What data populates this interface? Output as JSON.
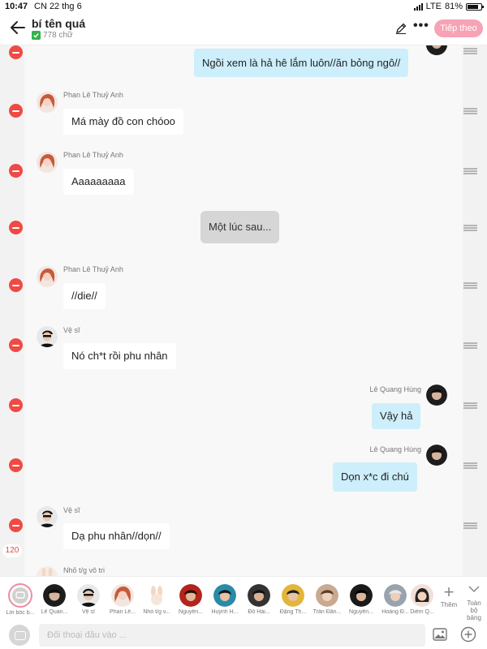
{
  "status_bar": {
    "time": "10:47",
    "date": "CN 22 thg 6",
    "network": "LTE",
    "battery": "81%",
    "battery_level": 0.81
  },
  "header": {
    "title": "bí tên quá",
    "word_count": "778 chữ",
    "continue_label": "Tiếp theo"
  },
  "messages": [
    {
      "side": "out",
      "avatar": "hung",
      "text": "Ngồi xem là hả hê lắm luôn//ăn bỏng ngô//"
    },
    {
      "side": "in",
      "sender": "Phan Lê Thuỷ Anh",
      "avatar": "thuy-anh",
      "text": "Má mày đồ con chóoo"
    },
    {
      "side": "in",
      "sender": "Phan Lê Thuỷ Anh",
      "avatar": "thuy-anh",
      "text": "Aaaaaaaaa"
    },
    {
      "side": "center",
      "text": "Một lúc sau..."
    },
    {
      "side": "in",
      "sender": "Phan Lê Thuỷ Anh",
      "avatar": "thuy-anh",
      "text": "//die//"
    },
    {
      "side": "in",
      "sender": "Vệ sĩ",
      "avatar": "ve-si",
      "text": "Nó ch*t rồi phu nhân"
    },
    {
      "side": "out",
      "sender": "Lê Quang Hùng",
      "avatar": "hung",
      "text": "Vậy hả"
    },
    {
      "side": "out",
      "sender": "Lê Quang Hùng",
      "avatar": "hung",
      "text": "Dọn x*c đi chú"
    },
    {
      "side": "in",
      "sender": "Vệ sĩ",
      "avatar": "ve-si",
      "text": "Dạ phu nhân//dọn//"
    },
    {
      "side": "in",
      "sender": "Nhỏ t/g vô tri",
      "avatar": "author",
      "text": ""
    }
  ],
  "count_badge": "120",
  "characters": [
    {
      "label": "Lời bốc b...",
      "avatar": "narration"
    },
    {
      "label": "Lê Quan...",
      "avatar": "hung"
    },
    {
      "label": "Vệ sĩ",
      "avatar": "ve-si"
    },
    {
      "label": "Phan Lê...",
      "avatar": "thuy-anh"
    },
    {
      "label": "Nhỏ t/g v...",
      "avatar": "author"
    },
    {
      "label": "Nguyễn...",
      "avatar": "c5"
    },
    {
      "label": "Huỳnh H...",
      "avatar": "c6"
    },
    {
      "label": "Đỗ Hải...",
      "avatar": "c7"
    },
    {
      "label": "Đặng Th...",
      "avatar": "c8"
    },
    {
      "label": "Trần Đăn...",
      "avatar": "c9"
    },
    {
      "label": "Nguyễn...",
      "avatar": "c10"
    },
    {
      "label": "Hoàng Đ...",
      "avatar": "c11"
    },
    {
      "label": "Diễm Q...",
      "avatar": "c12"
    }
  ],
  "add_character_label": "Thêm",
  "toggle_board_label": "Toàn bộ bảng",
  "input": {
    "placeholder": "Đối thoại đầu vào ..."
  },
  "colors": {
    "accent": "#f7a3b5",
    "delete": "#ef4a44",
    "bubble_out": "#cdeefb",
    "bubble_in": "#ffffff",
    "bubble_center": "#d6d6d6"
  }
}
